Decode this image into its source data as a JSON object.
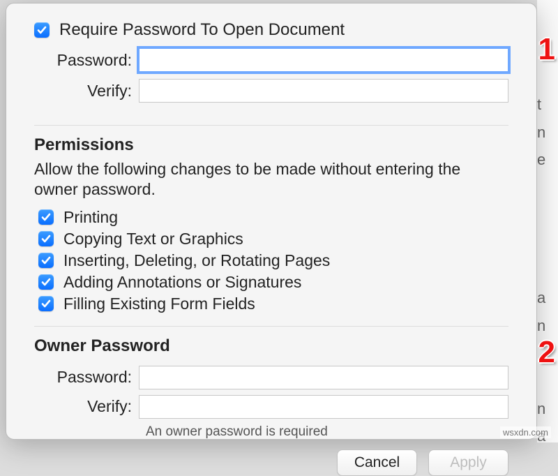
{
  "requirePassword": {
    "label": "Require Password To Open Document",
    "checked": true
  },
  "openPassword": {
    "passwordLabel": "Password:",
    "verifyLabel": "Verify:",
    "passwordValue": "",
    "verifyValue": ""
  },
  "permissions": {
    "title": "Permissions",
    "description": "Allow the following changes to be made without entering the owner password.",
    "items": [
      {
        "label": "Printing",
        "checked": true
      },
      {
        "label": "Copying Text or Graphics",
        "checked": true
      },
      {
        "label": "Inserting, Deleting, or Rotating Pages",
        "checked": true
      },
      {
        "label": "Adding Annotations or Signatures",
        "checked": true
      },
      {
        "label": "Filling Existing Form Fields",
        "checked": true
      }
    ]
  },
  "ownerPassword": {
    "title": "Owner Password",
    "passwordLabel": "Password:",
    "verifyLabel": "Verify:",
    "passwordValue": "",
    "verifyValue": "",
    "hint": "An owner password is required"
  },
  "buttons": {
    "cancel": "Cancel",
    "apply": "Apply"
  },
  "callouts": {
    "one": "1",
    "two": "2"
  },
  "watermark": "wsxdn.com"
}
